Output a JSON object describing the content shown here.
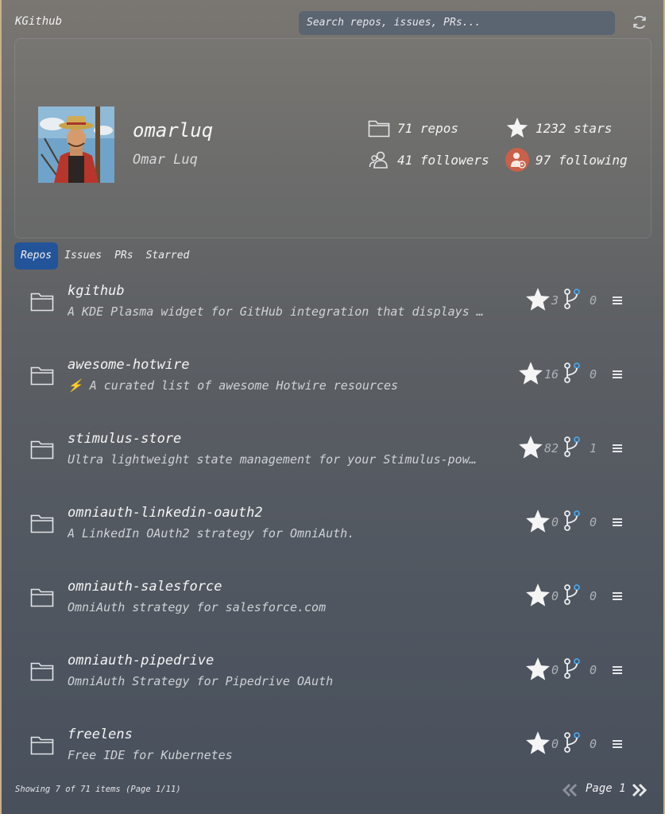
{
  "app": {
    "title": "KGithub"
  },
  "search": {
    "placeholder": "Search repos, issues, PRs..."
  },
  "profile": {
    "username": "omarluq",
    "full_name": "Omar Luq",
    "stats": {
      "repos": "71 repos",
      "stars": "1232 stars",
      "followers": "41 followers",
      "following": "97 following"
    }
  },
  "tabs": [
    "Repos",
    "Issues",
    "PRs",
    "Starred"
  ],
  "repos": [
    {
      "name": "kgithub",
      "description": "A KDE Plasma widget for GitHub integration that displays …",
      "stars": "3",
      "forks": "0"
    },
    {
      "name": "awesome-hotwire",
      "description": "⚡ A curated list of awesome Hotwire resources",
      "stars": "16",
      "forks": "0"
    },
    {
      "name": "stimulus-store",
      "description": "Ultra lightweight state management for your Stimulus-pow…",
      "stars": "82",
      "forks": "1"
    },
    {
      "name": "omniauth-linkedin-oauth2",
      "description": "A LinkedIn OAuth2 strategy for OmniAuth.",
      "stars": "0",
      "forks": "0"
    },
    {
      "name": "omniauth-salesforce",
      "description": "OmniAuth strategy for salesforce.com",
      "stars": "0",
      "forks": "0"
    },
    {
      "name": "omniauth-pipedrive",
      "description": "OmniAuth Strategy for Pipedrive OAuth",
      "stars": "0",
      "forks": "0"
    },
    {
      "name": "freelens",
      "description": "Free IDE for Kubernetes",
      "stars": "0",
      "forks": "0"
    }
  ],
  "footer": {
    "showing": "Showing 7 of 71 items (Page 1/11)",
    "page_label": "Page 1"
  },
  "colors": {
    "tab_active": "#23549a",
    "fork_accent": "#4aa3e8",
    "following_badge": "#c9604a"
  },
  "icons": [
    "refresh-icon",
    "folder-icon",
    "star-icon",
    "followers-icon",
    "following-icon",
    "fork-icon",
    "menu-icon",
    "chevron-double-left-icon",
    "chevron-double-right-icon"
  ]
}
